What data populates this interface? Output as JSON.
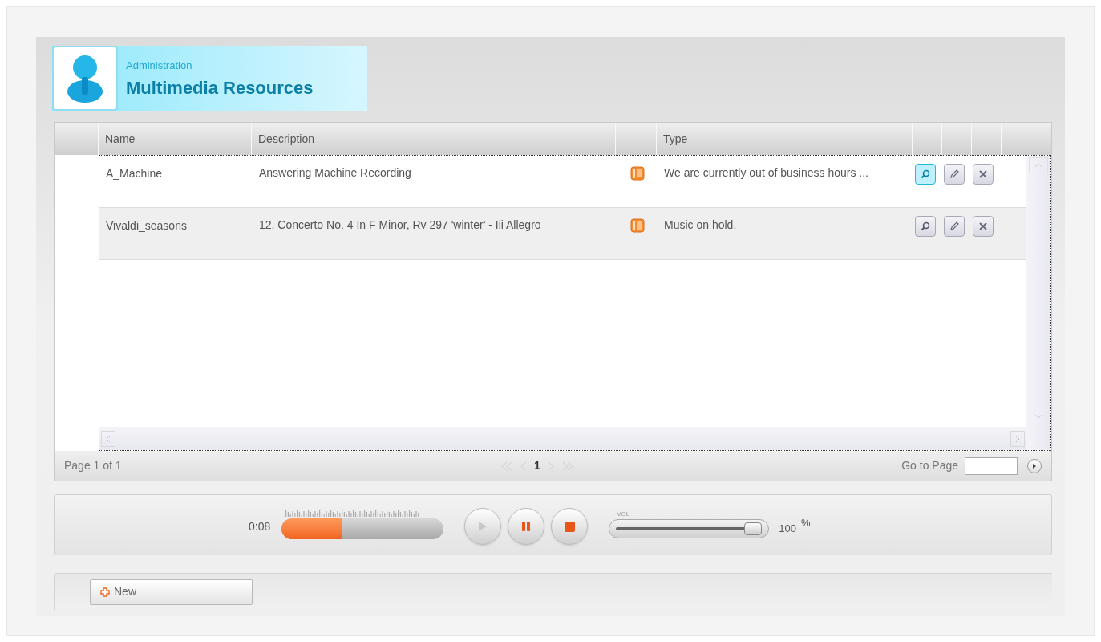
{
  "header": {
    "section": "Administration",
    "title": "Multimedia Resources"
  },
  "table": {
    "columns": [
      "Name",
      "Description",
      "Type"
    ],
    "rows": [
      {
        "name": "A_Machine",
        "description": "Answering Machine Recording",
        "type": "We are currently out of business hours ...",
        "view_selected": true
      },
      {
        "name": "Vivaldi_seasons",
        "description": "12. Concerto No. 4 In F Minor, Rv 297 'winter' - Iii Allegro",
        "type": "Music on hold.",
        "view_selected": false
      }
    ]
  },
  "pager": {
    "summary": "Page 1 of 1",
    "current_page": "1",
    "first_disabled": true,
    "prev_disabled": true,
    "next_disabled": true,
    "last_disabled": true,
    "goto_label": "Go to Page"
  },
  "player": {
    "time": "0:08",
    "progress": {
      "level": 0.37
    },
    "play_disabled": true,
    "pause_disabled": false,
    "stop_disabled": false,
    "volume_label": "VOL",
    "volume": {
      "level": 1
    },
    "volume_value": "100",
    "volume_unit": "%"
  },
  "toolbar": {
    "new_button": "New"
  }
}
